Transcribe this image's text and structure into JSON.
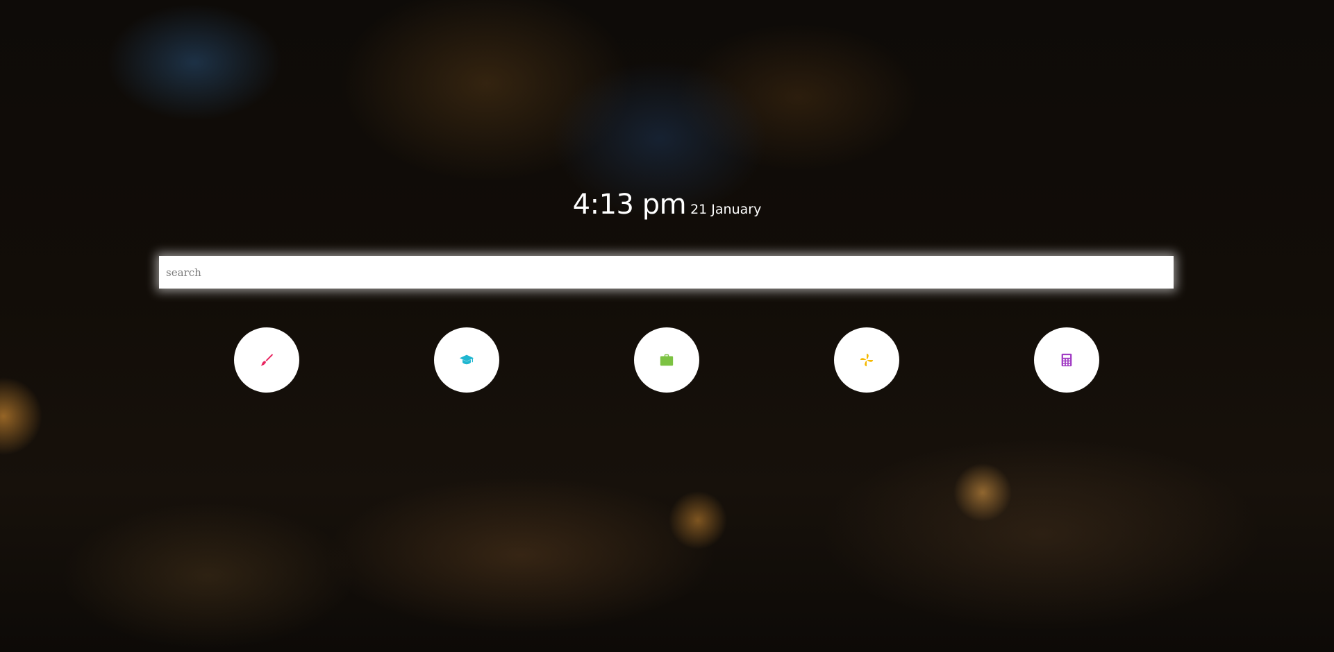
{
  "clock": {
    "time": "4:13 pm",
    "date": "21 January"
  },
  "search": {
    "placeholder": "search",
    "value": ""
  },
  "shortcuts": [
    {
      "icon": "paintbrush-icon",
      "color": "#e8245f"
    },
    {
      "icon": "graduation-cap-icon",
      "color": "#1fb6d0"
    },
    {
      "icon": "briefcase-icon",
      "color": "#7cc242"
    },
    {
      "icon": "pinwheel-icon",
      "color": "#f5b800"
    },
    {
      "icon": "calculator-icon",
      "color": "#a13cc4"
    }
  ]
}
